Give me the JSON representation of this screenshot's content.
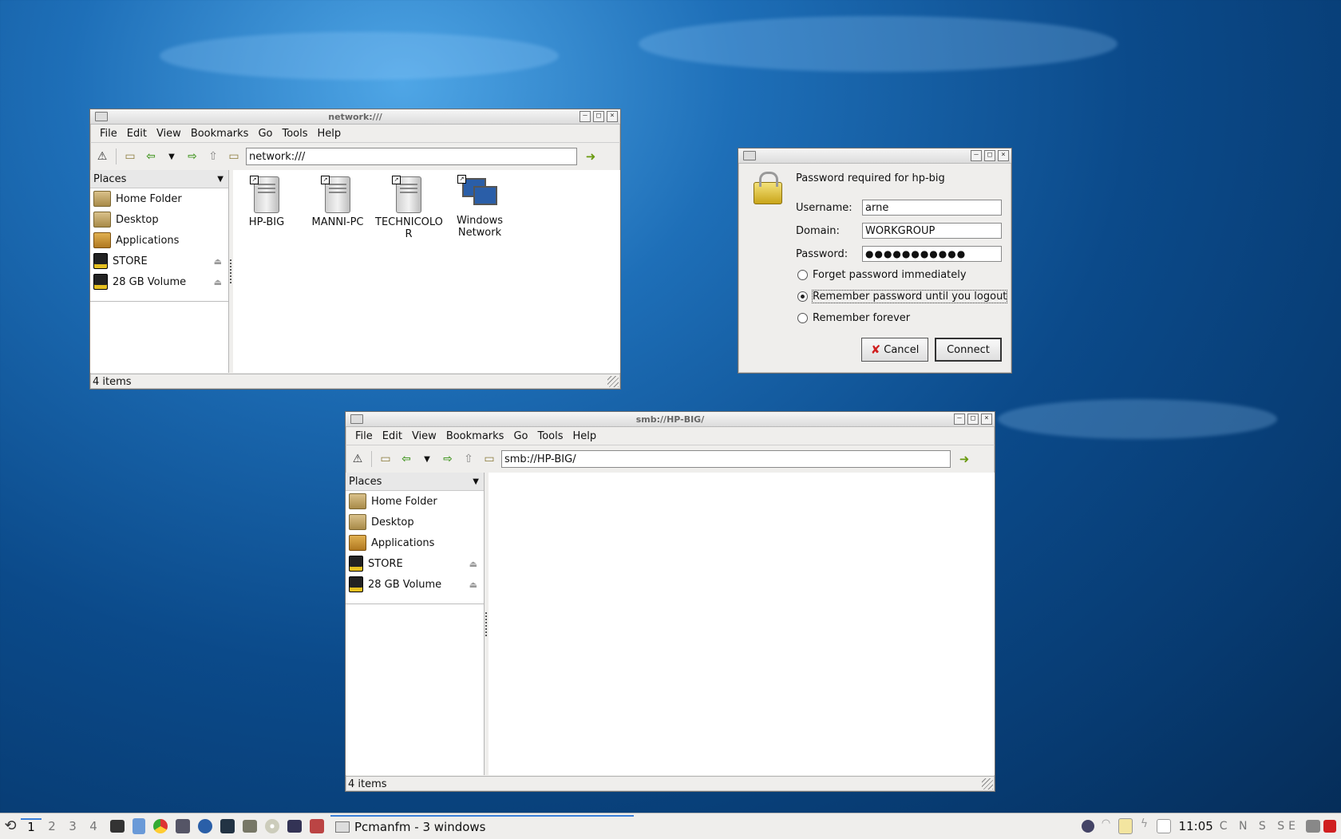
{
  "window1": {
    "title": "network:///",
    "menu": [
      "File",
      "Edit",
      "View",
      "Bookmarks",
      "Go",
      "Tools",
      "Help"
    ],
    "address": "network:///",
    "places_header": "Places",
    "places": [
      "Home Folder",
      "Desktop",
      "Applications",
      "STORE",
      "28 GB Volume"
    ],
    "items": [
      "HP-BIG",
      "MANNI-PC",
      "TECHNICOLO\nR",
      "Windows\nNetwork"
    ],
    "status": "4 items"
  },
  "window2": {
    "title": "smb://HP-BIG/",
    "menu": [
      "File",
      "Edit",
      "View",
      "Bookmarks",
      "Go",
      "Tools",
      "Help"
    ],
    "address": "smb://HP-BIG/",
    "places_header": "Places",
    "places": [
      "Home Folder",
      "Desktop",
      "Applications",
      "STORE",
      "28 GB Volume"
    ],
    "status": "4 items"
  },
  "dialog": {
    "message": "Password required for hp-big",
    "username_label": "Username:",
    "username_value": "arne",
    "domain_label": "Domain:",
    "domain_value": "WORKGROUP",
    "password_label": "Password:",
    "password_value": "●●●●●●●●●●●",
    "options": [
      "Forget password immediately",
      "Remember password until you logout",
      "Remember forever"
    ],
    "selected_option": 1,
    "cancel_label": "Cancel",
    "connect_label": "Connect"
  },
  "taskbar": {
    "workspaces": [
      "1",
      "2",
      "3",
      "4"
    ],
    "task_label": "Pcmanfm - 3 windows",
    "clock": "11:05",
    "keyboard_indicators": "C N S SE"
  },
  "colors": {
    "accent": "#3a7fd8",
    "desktop": "#0b4a8a"
  }
}
